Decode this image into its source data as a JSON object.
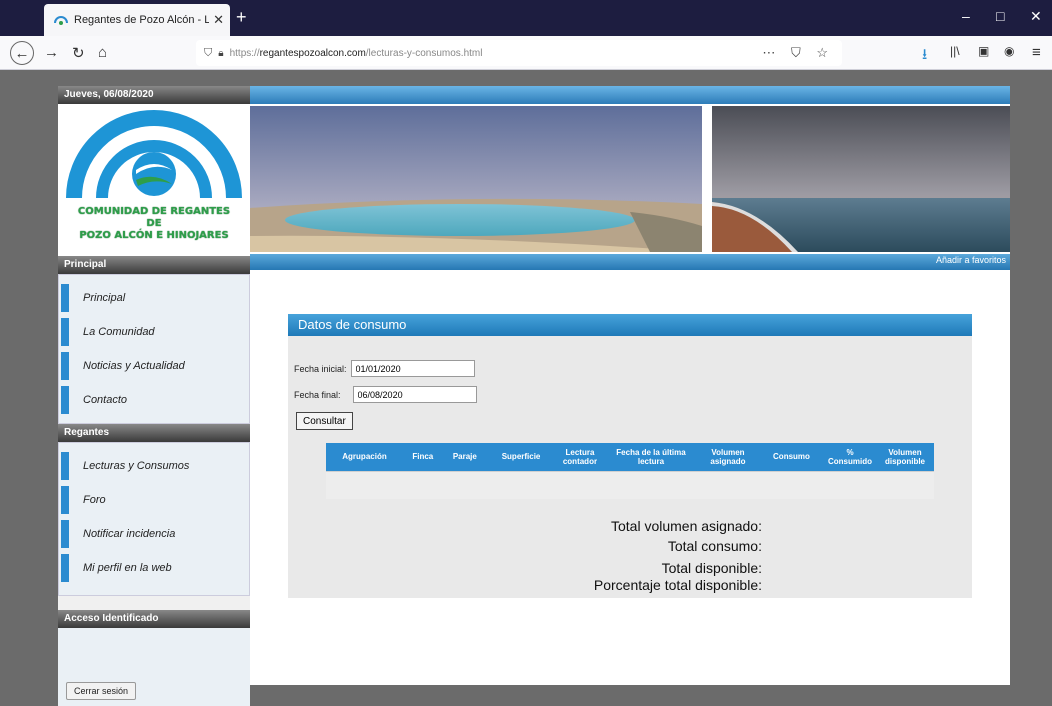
{
  "browser": {
    "tab_title": "Regantes de Pozo Alcón - Lect",
    "url_prefix": "https://",
    "url_domain": "regantespozoalcon.com",
    "url_path": "/lecturas-y-consumos.html"
  },
  "sidebar": {
    "date": "Jueves, 06/08/2020",
    "logo_line1": "COMUNIDAD DE REGANTES",
    "logo_line2": "DE",
    "logo_line3": "POZO ALCÓN E HINOJARES",
    "principal_header": "Principal",
    "principal_items": [
      "Principal",
      "La Comunidad",
      "Noticias y Actualidad",
      "Contacto"
    ],
    "regantes_header": "Regantes",
    "regantes_items": [
      "Lecturas y Consumos",
      "Foro",
      "Notificar incidencia",
      "Mi perfil en la web"
    ],
    "login_header": "Acceso Identificado",
    "logout_label": "Cerrar sesión"
  },
  "banner": {
    "favorites_link": "Añadir a favoritos"
  },
  "form": {
    "title": "Datos de consumo",
    "start_label": "Fecha inicial:",
    "start_value": "01/01/2020",
    "end_label": "Fecha final:",
    "end_value": "06/08/2020",
    "submit_label": "Consultar",
    "columns": [
      "Agrupación",
      "Finca",
      "Paraje",
      "Superficie",
      "Lectura contador",
      "Fecha de la última lectura",
      "Volumen asignado",
      "Consumo",
      "% Consumido",
      "Volumen disponible"
    ],
    "totals": [
      "Total volumen asignado:",
      "Total consumo:",
      "Total disponible:",
      "Porcentaje total disponible:"
    ]
  }
}
